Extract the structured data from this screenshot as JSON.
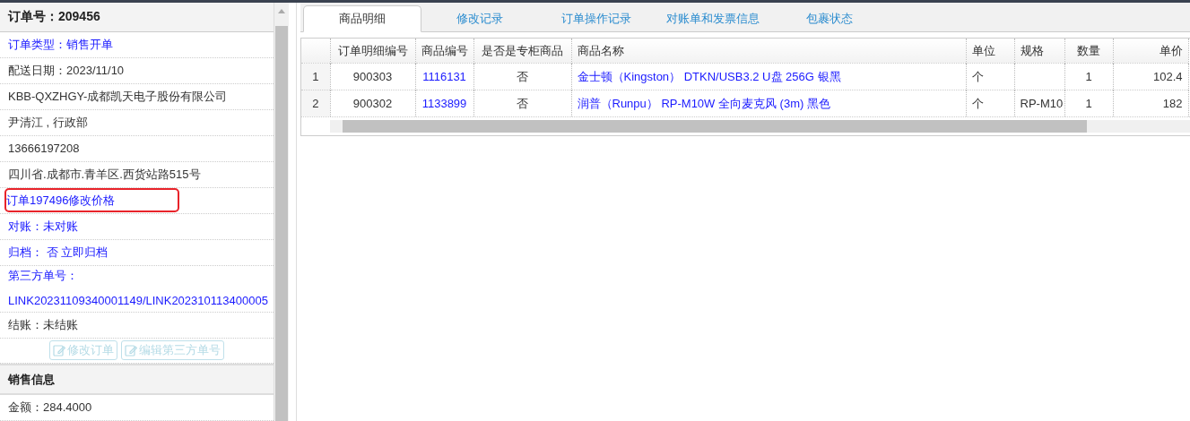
{
  "order_panel": {
    "title": "订单号：209456",
    "items": [
      {
        "kind": "link",
        "text": "订单类型：销售开单"
      },
      {
        "kind": "text",
        "text": "配送日期：2023/11/10"
      },
      {
        "kind": "text",
        "text": "KBB-QXZHGY-成都凯天电子股份有限公司"
      },
      {
        "kind": "text",
        "text": "尹清江 , 行政部"
      },
      {
        "kind": "text",
        "text": "13666197208"
      },
      {
        "kind": "text",
        "text": "四川省.成都市.青羊区.西货站路515号"
      },
      {
        "kind": "link",
        "text": "订单197496修改价格",
        "highlighted": true
      },
      {
        "kind": "link",
        "text": "对账：未对账"
      },
      {
        "kind": "link",
        "text": "归档： 否 立即归档"
      },
      {
        "kind": "link",
        "text": "第三方单号：",
        "value": "LINK20231109340001149/LINK202310113400005"
      },
      {
        "kind": "text",
        "text": "结账：未结账"
      }
    ],
    "buttons": [
      {
        "label": "修改订单",
        "disabled": true
      },
      {
        "label": "编辑第三方单号",
        "disabled": true
      }
    ],
    "sales_section": {
      "title": "销售信息",
      "items": [
        "金额：284.4000"
      ]
    }
  },
  "tabs": [
    {
      "label": "商品明细",
      "selected": true
    },
    {
      "label": "修改记录",
      "selected": false
    },
    {
      "label": "订单操作记录",
      "selected": false
    },
    {
      "label": "对账单和发票信息",
      "selected": false
    },
    {
      "label": "包裹状态",
      "selected": false
    }
  ],
  "table": {
    "columns": [
      {
        "label": "订单明细编号",
        "kind": "text"
      },
      {
        "label": "商品编号",
        "kind": "link"
      },
      {
        "label": "是否是专柜商品",
        "kind": "text"
      },
      {
        "label": "商品名称",
        "kind": "link"
      },
      {
        "label": "单位",
        "kind": "text"
      },
      {
        "label": "规格",
        "kind": "text"
      },
      {
        "label": "数量",
        "kind": "text"
      },
      {
        "label": "单价",
        "kind": "text"
      }
    ],
    "rows": [
      {
        "number": "1",
        "cells": [
          "900303",
          "1116131",
          "否",
          "金士顿（Kingston） DTKN/USB3.2 U盘 256G 银黑",
          "个",
          "",
          "1",
          "102.4"
        ]
      },
      {
        "number": "2",
        "cells": [
          "900302",
          "1133899",
          "否",
          "润普（Runpu） RP-M10W 全向麦克风 (3m) 黑色",
          "个",
          "RP-M10",
          "1",
          "182"
        ]
      }
    ]
  }
}
